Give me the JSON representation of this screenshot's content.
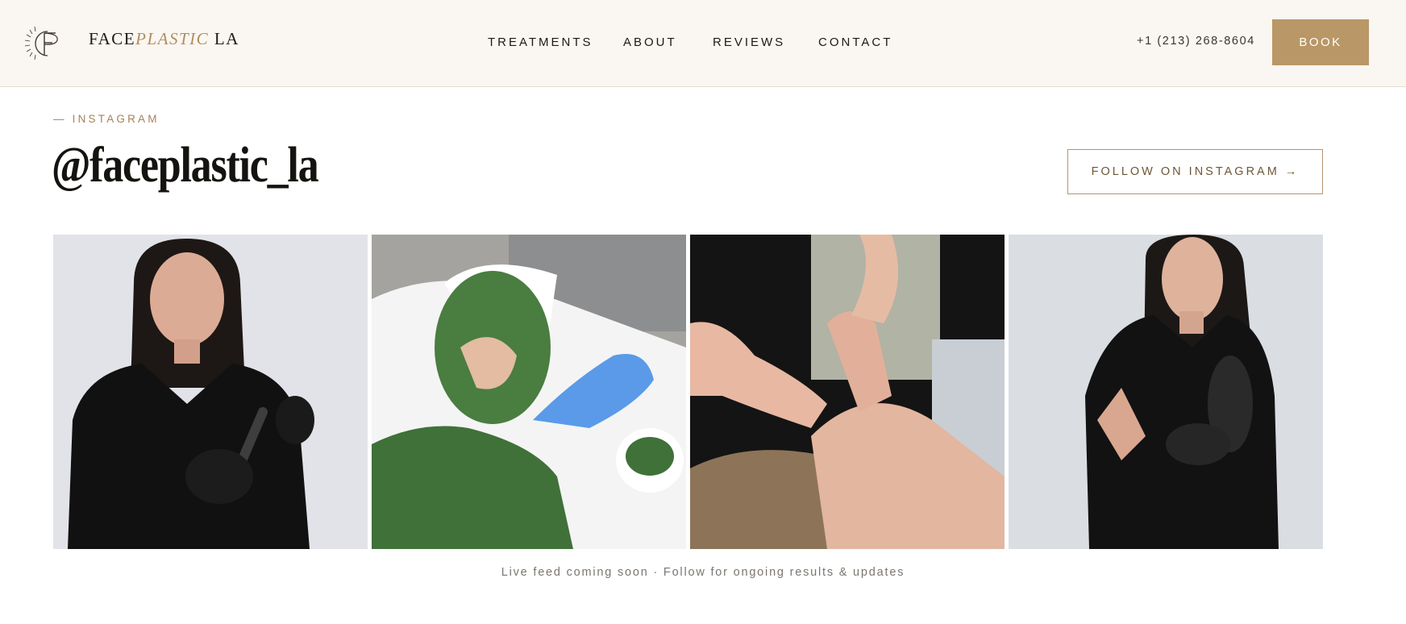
{
  "header": {
    "brand": {
      "part1": "FACE",
      "part2": "PLASTIC",
      "part3": " LA"
    },
    "nav": [
      {
        "label": "TREATMENTS"
      },
      {
        "label": "ABOUT"
      },
      {
        "label": "REVIEWS"
      },
      {
        "label": "CONTACT"
      }
    ],
    "phone": "+1 (213) 268-8604",
    "book_label": "BOOK"
  },
  "instagram": {
    "eyebrow": "— INSTAGRAM",
    "handle": "@faceplastic_la",
    "follow_label": "FOLLOW ON INSTAGRAM →",
    "caption": "Live feed coming soon · Follow for ongoing results & updates"
  },
  "colors": {
    "header_bg": "#faf6f1",
    "accent_gold": "#b99766",
    "text_dark": "#1c1a17",
    "eyebrow": "#a5825a"
  }
}
